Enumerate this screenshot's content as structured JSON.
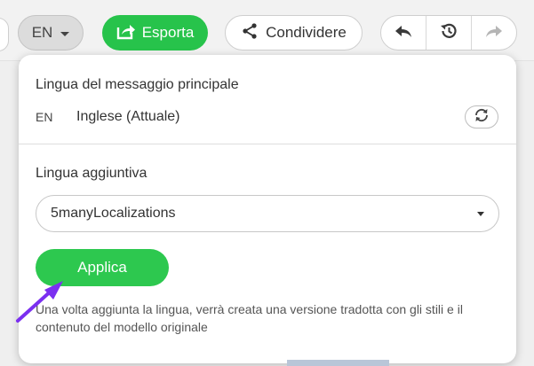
{
  "toolbar": {
    "language_button": {
      "label": "EN",
      "icon": "chevron-down-icon"
    },
    "export_button": {
      "label": "Esporta",
      "icon": "export-icon"
    },
    "share_button": {
      "label": "Condividere",
      "icon": "share-icon"
    },
    "history": {
      "undo_icon": "undo-icon",
      "history_icon": "history-icon",
      "redo_icon": "redo-icon"
    }
  },
  "panel": {
    "main_language_title": "Lingua del messaggio principale",
    "main_language_code": "EN",
    "main_language_name": "Inglese (Attuale)",
    "swap_icon": "refresh-icon",
    "additional_language_title": "Lingua aggiuntiva",
    "additional_language_selected": "5manyLocalizations",
    "apply_label": "Applica",
    "hint": "Una volta aggiunta la lingua, verrà creata una versione tradotta con gli stili e il contenuto del modello originale"
  },
  "colors": {
    "accent_green": "#2dc84f",
    "arrow_purple": "#7b2ff0"
  }
}
